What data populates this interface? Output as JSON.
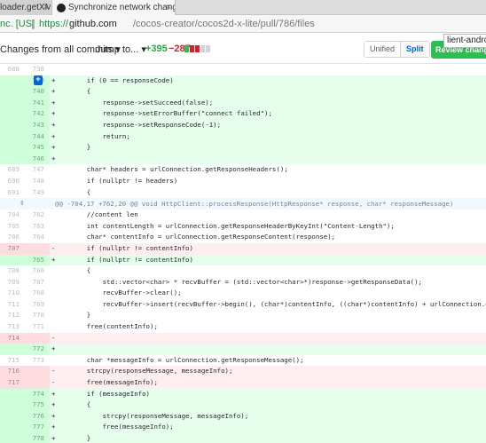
{
  "browser": {
    "tabs": [
      {
        "label": "loader.getXM",
        "active": false
      },
      {
        "label": "Synchronize network changes",
        "active": true
      }
    ],
    "address": {
      "cert": "nc. [US]",
      "protocol": "https://",
      "host": "github.com",
      "path": "/cocos-creator/cocos2d-x-lite/pull/786/files"
    },
    "tooltip": "lient-android"
  },
  "pr_toolbar": {
    "changes_label": "Changes from all commits ▾",
    "jump_label": "Jump to... ▾",
    "additions": "+395",
    "deletions": "−287",
    "diffstat_blocks": [
      "#2cbe4e",
      "#cb2431",
      "#cb2431",
      "#d1d5da",
      "#d1d5da"
    ],
    "view_unified": "Unified",
    "view_split": "Split",
    "review_button": "Review changes"
  },
  "colors": {
    "add_bg": "#e6ffed",
    "del_bg": "#ffeef0",
    "hunk_bg": "#f1f8ff",
    "accent": "#0366d6"
  },
  "diff": {
    "rows": [
      {
        "type": "ctx",
        "old": "688",
        "new": "738",
        "mark": "",
        "code": ""
      },
      {
        "type": "add",
        "old": "",
        "new": "739",
        "mark": "+",
        "code": "    if (0 == responseCode)",
        "addbtn": true
      },
      {
        "type": "add",
        "old": "",
        "new": "740",
        "mark": "+",
        "code": "    {"
      },
      {
        "type": "add",
        "old": "",
        "new": "741",
        "mark": "+",
        "code": "        response->setSucceed(false);"
      },
      {
        "type": "add",
        "old": "",
        "new": "742",
        "mark": "+",
        "code": "        response->setErrorBuffer(\"connect failed\");"
      },
      {
        "type": "add",
        "old": "",
        "new": "743",
        "mark": "+",
        "code": "        response->setResponseCode(-1);"
      },
      {
        "type": "add",
        "old": "",
        "new": "744",
        "mark": "+",
        "code": "        return;"
      },
      {
        "type": "add",
        "old": "",
        "new": "745",
        "mark": "+",
        "code": "    }"
      },
      {
        "type": "add",
        "old": "",
        "new": "746",
        "mark": "+",
        "code": ""
      },
      {
        "type": "ctx",
        "old": "689",
        "new": "747",
        "mark": "",
        "code": "    char* headers = urlConnection.getResponseHeaders();"
      },
      {
        "type": "ctx",
        "old": "690",
        "new": "748",
        "mark": "",
        "code": "    if (nullptr != headers)"
      },
      {
        "type": "ctx",
        "old": "691",
        "new": "749",
        "mark": "",
        "code": "    {"
      },
      {
        "type": "hunk",
        "old": "",
        "new": "",
        "mark": "",
        "code": "@@ -704,17 +762,20 @@ void HttpClient::processResponse(HttpResponse* response, char* responseMessage)"
      },
      {
        "type": "ctx",
        "old": "704",
        "new": "762",
        "mark": "",
        "code": "    //content len"
      },
      {
        "type": "ctx",
        "old": "705",
        "new": "763",
        "mark": "",
        "code": "    int contentLength = urlConnection.getResponseHeaderByKeyInt(\"Content-Length\");"
      },
      {
        "type": "ctx",
        "old": "706",
        "new": "764",
        "mark": "",
        "code": "    char* contentInfo = urlConnection.getResponseContent(response);"
      },
      {
        "type": "del",
        "old": "707",
        "new": "",
        "mark": "-",
        "code": "    if (nullptr != contentInfo)"
      },
      {
        "type": "add",
        "old": "",
        "new": "765",
        "mark": "+",
        "code": "    if (nullptr != contentInfo) "
      },
      {
        "type": "ctx",
        "old": "708",
        "new": "766",
        "mark": "",
        "code": "    {"
      },
      {
        "type": "ctx",
        "old": "709",
        "new": "767",
        "mark": "",
        "code": "        std::vector<char> * recvBuffer = (std::vector<char>*)response->getResponseData();"
      },
      {
        "type": "ctx",
        "old": "710",
        "new": "768",
        "mark": "",
        "code": "        recvBuffer->clear();"
      },
      {
        "type": "ctx",
        "old": "711",
        "new": "769",
        "mark": "",
        "code": "        recvBuffer->insert(recvBuffer->begin(), (char*)contentInfo, ((char*)contentInfo) + urlConnection.getContentLength());"
      },
      {
        "type": "ctx",
        "old": "712",
        "new": "770",
        "mark": "",
        "code": "    }"
      },
      {
        "type": "ctx",
        "old": "713",
        "new": "771",
        "mark": "",
        "code": "    free(contentInfo);"
      },
      {
        "type": "del",
        "old": "714",
        "new": "",
        "mark": "-",
        "code": ""
      },
      {
        "type": "add",
        "old": "",
        "new": "772",
        "mark": "+",
        "code": " "
      },
      {
        "type": "ctx",
        "old": "715",
        "new": "773",
        "mark": "",
        "code": "    char *messageInfo = urlConnection.getResponseMessage();"
      },
      {
        "type": "del",
        "old": "716",
        "new": "",
        "mark": "-",
        "code": "    strcpy(responseMessage, messageInfo);"
      },
      {
        "type": "del",
        "old": "717",
        "new": "",
        "mark": "-",
        "code": "    free(messageInfo);"
      },
      {
        "type": "add",
        "old": "",
        "new": "774",
        "mark": "+",
        "code": "    if (messageInfo)"
      },
      {
        "type": "add",
        "old": "",
        "new": "775",
        "mark": "+",
        "code": "    {"
      },
      {
        "type": "add",
        "old": "",
        "new": "776",
        "mark": "+",
        "code": "        strcpy(responseMessage, messageInfo);"
      },
      {
        "type": "add",
        "old": "",
        "new": "777",
        "mark": "+",
        "code": "        free(messageInfo);"
      },
      {
        "type": "add",
        "old": "",
        "new": "778",
        "mark": "+",
        "code": "    }"
      }
    ]
  }
}
